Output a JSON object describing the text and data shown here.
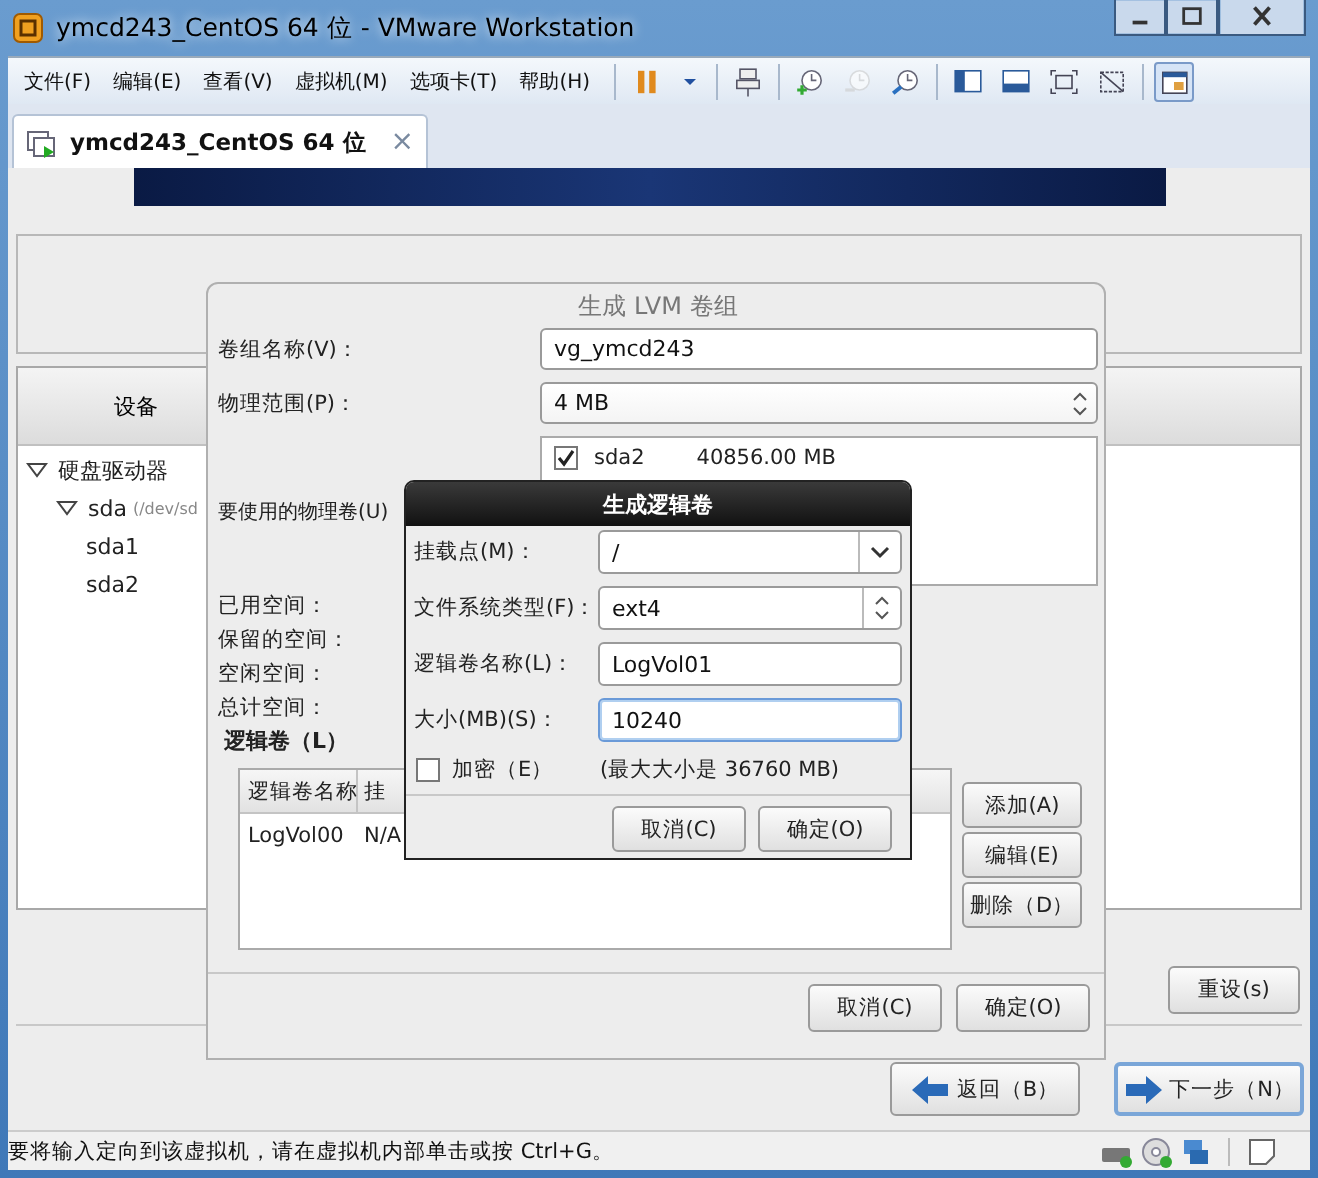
{
  "window": {
    "title": "ymcd243_CentOS 64 位 - VMware Workstation"
  },
  "menu": [
    {
      "label": "文件(F)"
    },
    {
      "label": "编辑(E)"
    },
    {
      "label": "查看(V)"
    },
    {
      "label": "虚拟机(M)"
    },
    {
      "label": "选项卡(T)"
    },
    {
      "label": "帮助(H)"
    }
  ],
  "toolbar": {
    "groups": [
      [
        {
          "kind": "pause",
          "disabled": false,
          "selected": false
        },
        {
          "kind": "dropdown",
          "disabled": false,
          "selected": false
        }
      ],
      [
        {
          "kind": "send-keys",
          "disabled": false,
          "selected": false
        }
      ],
      [
        {
          "kind": "snapshot-take",
          "disabled": false,
          "selected": false
        },
        {
          "kind": "snapshot-revert",
          "disabled": true,
          "selected": false
        },
        {
          "kind": "snapshot-manage",
          "disabled": false,
          "selected": false
        }
      ],
      [
        {
          "kind": "sidebar",
          "disabled": false,
          "selected": false
        },
        {
          "kind": "thumbnail",
          "disabled": false,
          "selected": false
        },
        {
          "kind": "fullscreen",
          "disabled": false,
          "selected": false
        },
        {
          "kind": "unity",
          "disabled": false,
          "selected": false
        }
      ],
      [
        {
          "kind": "console",
          "disabled": false,
          "selected": true
        }
      ]
    ]
  },
  "tabs": [
    {
      "label": "ymcd243_CentOS 64 位",
      "selected": true,
      "close": "×"
    }
  ],
  "installer": {
    "device_column": "设备",
    "tree": [
      {
        "label": "硬盘驱动器",
        "expanded": true,
        "children": [
          {
            "label": "sda",
            "detail": "(/dev/sd",
            "expanded": true,
            "children": [
              {
                "label": "sda1"
              },
              {
                "label": "sda2"
              }
            ]
          }
        ]
      }
    ],
    "reset_button": "重设(s)",
    "nav": [
      {
        "kind": "back",
        "label": "返回（B）",
        "default": false
      },
      {
        "kind": "next",
        "label": "下一步（N）",
        "default": true
      }
    ]
  },
  "lvm_dialog": {
    "title": "生成 LVM 卷组",
    "group_name": {
      "label": "卷组名称(V)：",
      "value": "vg_ymcd243"
    },
    "extent": {
      "label": "物理范围(P)：",
      "value": "4 MB"
    },
    "physical_volumes": {
      "label": "要使用的物理卷(U)",
      "items": [
        {
          "name": "sda2",
          "size": "40856.00 MB",
          "checked": true
        }
      ]
    },
    "space_labels": [
      "已用空间：",
      "保留的空间：",
      "空闲空间：",
      "总计空间："
    ],
    "section": "逻辑卷（L）",
    "table": {
      "columns": [
        "逻辑卷名称",
        "挂"
      ],
      "rows": [
        [
          "LogVol00",
          "N/A"
        ]
      ]
    },
    "side_buttons": [
      "添加(A)",
      "编辑(E)",
      "删除（D）"
    ],
    "buttons": [
      "取消(C)",
      "确定(O)"
    ]
  },
  "lv_dialog": {
    "title": "生成逻辑卷",
    "fields": [
      {
        "kind": "combo-entry",
        "label": "挂载点(M)：",
        "value": "/",
        "focused": false
      },
      {
        "kind": "combo",
        "label": "文件系统类型(F)：",
        "value": "ext4",
        "focused": false
      },
      {
        "kind": "entry",
        "label": "逻辑卷名称(L)：",
        "value": "LogVol01",
        "focused": false
      },
      {
        "kind": "entry",
        "label": "大小(MB)(S)：",
        "value": "10240",
        "focused": true
      }
    ],
    "encrypt": {
      "label": "加密（E）",
      "checked": false
    },
    "max_size": "(最大大小是 36760 MB)",
    "buttons": [
      "取消(C)",
      "确定(O)"
    ]
  },
  "status_bar": {
    "text": "要将输入定向到该虚拟机，请在虚拟机内部单击或按 Ctrl+G。"
  }
}
